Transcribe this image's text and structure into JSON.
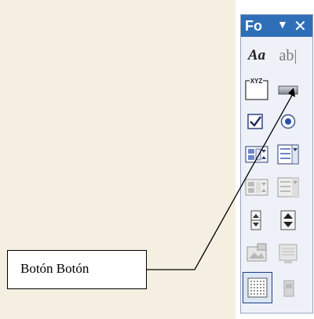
{
  "toolbox": {
    "title": "Fo",
    "dropdown_glyph": "▼",
    "close_glyph": "✕",
    "label_tool_text": "Aa",
    "textbox_tool_text": "ab|",
    "option_group_text": "XYZ",
    "tools": [
      "label-icon",
      "textbox-icon",
      "option-group-icon",
      "button-icon",
      "checkbox-icon",
      "option-button-icon",
      "list-box-icon",
      "combo-box-icon",
      "list-box-disabled-icon",
      "combo-box-disabled-icon",
      "spin-button-icon",
      "scrollbar-icon",
      "image-icon",
      "unbound-frame-icon",
      "grid-icon",
      "page-break-icon"
    ]
  },
  "callout": {
    "label": "Botón Botón"
  },
  "colors": {
    "background": "#f5efe2",
    "titlebar": "#2f6fb8",
    "toolbox_bg": "#eef1f8",
    "selected": "#dce6f5"
  }
}
